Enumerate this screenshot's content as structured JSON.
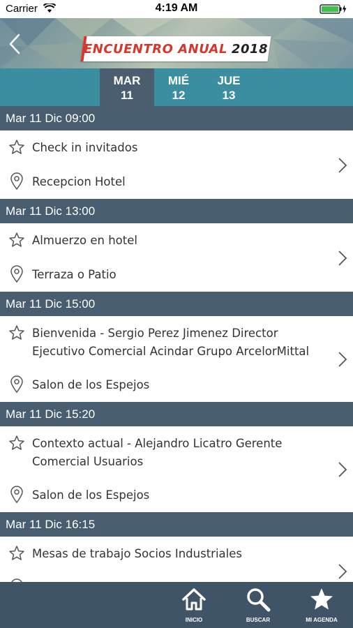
{
  "status_bar": {
    "carrier": "Carrier",
    "time": "4:19 AM"
  },
  "header": {
    "title_main": "ENCUENTRO ANUAL",
    "title_year": "2018"
  },
  "day_tabs": [
    {
      "day": "MAR",
      "num": "11",
      "active": true
    },
    {
      "day": "MIÉ",
      "num": "12",
      "active": false
    },
    {
      "day": "JUE",
      "num": "13",
      "active": false
    }
  ],
  "sessions": [
    {
      "time": "Mar 11 Dic 09:00",
      "title_lines": [
        "Check in invitados"
      ],
      "location": "Recepcion Hotel"
    },
    {
      "time": "Mar 11 Dic 13:00",
      "title_lines": [
        "Almuerzo en hotel"
      ],
      "location": "Terraza o Patio"
    },
    {
      "time": "Mar 11 Dic 15:00",
      "title_lines": [
        "Bienvenida - Sergio Perez Jimenez Director",
        "Ejecutivo Comercial Acindar Grupo ArcelorMittal"
      ],
      "location": "Salon de los Espejos"
    },
    {
      "time": "Mar 11 Dic 15:20",
      "title_lines": [
        "Contexto actual - Alejandro Licatro Gerente",
        "Comercial Usuarios"
      ],
      "location": "Salon de los Espejos"
    },
    {
      "time": "Mar 11 Dic 16:15",
      "title_lines": [
        "Mesas de trabajo Socios Industriales"
      ],
      "location": ""
    }
  ],
  "bottom_nav": [
    {
      "label": "INICIO",
      "icon": "home-icon"
    },
    {
      "label": "BUSCAR",
      "icon": "search-icon"
    },
    {
      "label": "MI AGENDA",
      "icon": "star-icon"
    }
  ],
  "colors": {
    "accent_red": "#d6372d",
    "tab_bar": "#3a8ea0",
    "tab_active": "#4a5e70",
    "section_header": "#485d70",
    "bottom_nav": "#3f5567"
  }
}
